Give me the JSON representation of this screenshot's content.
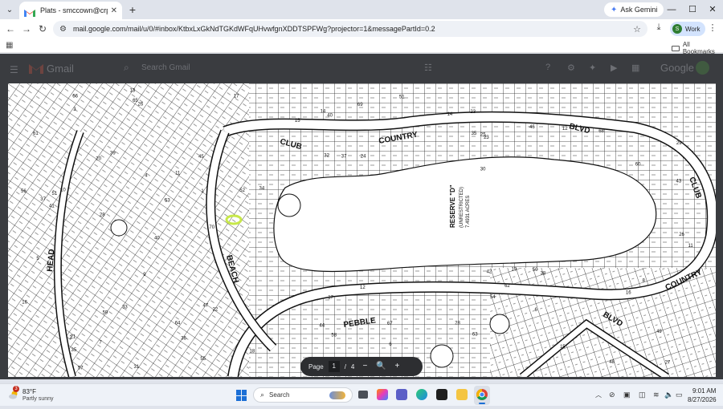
{
  "browser": {
    "tab_title": "Plats - smccown@crp-tx.com -",
    "ask_gemini_label": "Ask Gemini",
    "url": "mail.google.com/mail/u/0/#inbox/KtbxLxGkNdTGKdWFqUHvwfgnXDDTSPFWg?projector=1&messagePartId=0.2",
    "profile_initial": "S",
    "profile_label": "Work",
    "all_bookmarks_label": "All Bookmarks",
    "window_minimize": "—",
    "window_maximize": "☐",
    "window_close": "✕"
  },
  "gmail": {
    "logo_text": "Gmail",
    "search_placeholder": "Search Gmail",
    "google_text": "Google"
  },
  "plat": {
    "street_labels": [
      {
        "text": "COUNTRY"
      },
      {
        "text": "CLUB"
      },
      {
        "text": "BLVD"
      },
      {
        "text": "PEBBLE"
      },
      {
        "text": "BEACH"
      },
      {
        "text": "HEAD"
      },
      {
        "text": "COUNTRY"
      },
      {
        "text": "CLUB"
      },
      {
        "text": "BLVD"
      }
    ],
    "reserve_label": "RESERVE \"D\"",
    "reserve_sub": "(UNRESTRICTED)",
    "reserve_acres": "7.4931 ACRES",
    "lot_numbers": [
      "20",
      "21",
      "22",
      "23",
      "24",
      "25",
      "26",
      "27",
      "28",
      "29",
      "30",
      "31",
      "32",
      "33",
      "34",
      "35",
      "36",
      "37",
      "38",
      "39",
      "40",
      "41",
      "42",
      "43",
      "44",
      "45",
      "46",
      "47",
      "48",
      "49",
      "50",
      "51",
      "52",
      "53",
      "54",
      "55",
      "56",
      "57",
      "58",
      "59",
      "60",
      "61",
      "62",
      "63",
      "64",
      "65",
      "66",
      "67",
      "68",
      "69",
      "70",
      "10",
      "11",
      "12",
      "13",
      "14",
      "15",
      "16",
      "17",
      "18",
      "19",
      "1",
      "2",
      "3",
      "4",
      "5",
      "6",
      "7",
      "8",
      "9",
      "12",
      "15",
      "20",
      "28",
      "14",
      "11",
      "6",
      "16",
      "51",
      "29",
      "35",
      "23",
      "40",
      "17",
      "26",
      "37",
      "9"
    ]
  },
  "viewer": {
    "page_label": "Page",
    "current_page": "1",
    "separator": "/",
    "total_pages": "4",
    "zoom_out": "−",
    "zoom_icon": "🔍",
    "zoom_in": "+"
  },
  "taskbar": {
    "weather_badge": "3",
    "weather_temp": "83°F",
    "weather_desc": "Partly sunny",
    "search_label": "Search",
    "clock_time": "9:01 AM",
    "clock_date": "8/27/2026"
  },
  "colors": {
    "overlay": "#3a3c40",
    "highlight": "#c7e84a",
    "page_controls_bg": "#2d2e31",
    "chrome_frame": "#dfe3eb"
  }
}
